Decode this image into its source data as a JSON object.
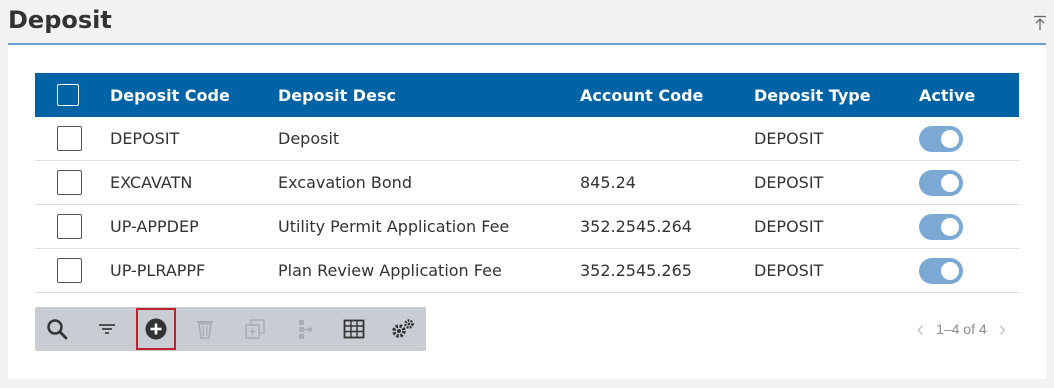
{
  "page": {
    "title": "Deposit"
  },
  "table": {
    "columns": [
      "Deposit Code",
      "Deposit Desc",
      "Account Code",
      "Deposit Type",
      "Active"
    ],
    "rows": [
      {
        "code": "DEPOSIT",
        "desc": "Deposit",
        "account": "",
        "type": "DEPOSIT",
        "active": true
      },
      {
        "code": "EXCAVATN",
        "desc": "Excavation Bond",
        "account": "845.24",
        "type": "DEPOSIT",
        "active": true
      },
      {
        "code": "UP-APPDEP",
        "desc": "Utility Permit Application Fee",
        "account": "352.2545.264",
        "type": "DEPOSIT",
        "active": true
      },
      {
        "code": "UP-PLRAPPF",
        "desc": "Plan Review Application Fee",
        "account": "352.2545.265",
        "type": "DEPOSIT",
        "active": true
      }
    ]
  },
  "toolbar": {
    "buttons": [
      "search-icon",
      "filter-icon",
      "add-icon",
      "delete-icon",
      "copy-icon",
      "hierarchy-icon",
      "table-view-icon",
      "settings-icon"
    ],
    "selected": "add-icon"
  },
  "pager": {
    "range": "1–4 of 4",
    "prev": "‹",
    "next": "›"
  },
  "colors": {
    "header": "#0063a5",
    "toggle_on": "#7ba9d4",
    "accent_line": "#6aa0d1",
    "selected_outline": "#c0202a"
  }
}
